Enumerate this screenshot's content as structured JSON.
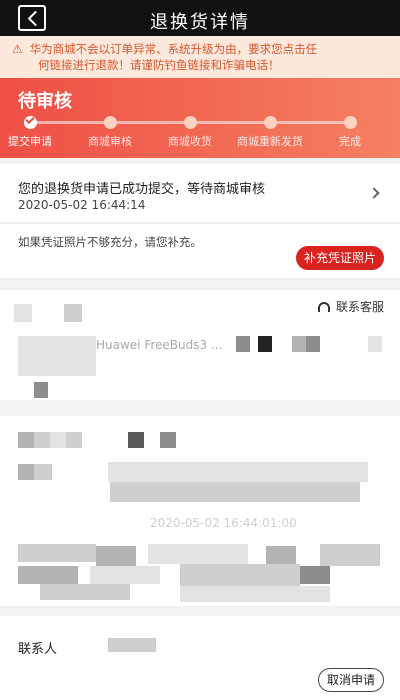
{
  "header": {
    "title": "退换货详情"
  },
  "notice": {
    "line1": "华为商城不会以订单异常、系统升级为由，要求您点击任",
    "line2": "何链接进行退款！请谨防钓鱼链接和诈骗电话！",
    "icon": "warning-icon"
  },
  "progress": {
    "status": "待审核",
    "completed_fraction": 0,
    "steps": [
      {
        "label": "提交申请",
        "active": true
      },
      {
        "label": "商城审核",
        "active": false
      },
      {
        "label": "商城收货",
        "active": false
      },
      {
        "label": "商城重新发货",
        "active": false
      },
      {
        "label": "完成",
        "active": false
      }
    ]
  },
  "status_card": {
    "message": "您的退换货申请已成功提交，等待商城审核",
    "time": "2020-05-02 16:44:14"
  },
  "supplement": {
    "text": "如果凭证照片不够充分，请您补充。",
    "button": "补充凭证照片"
  },
  "product": {
    "customer_service": "联系客服",
    "faint_text": "Huawei FreeBuds3 ..."
  },
  "order": {
    "faint_time": "2020-05-02 16:44:01:00"
  },
  "contact": {
    "label": "联系人",
    "cancel_button": "取消申请"
  },
  "colors": {
    "accent_red": "#d8231f",
    "progress_start": "#ef4f45",
    "progress_end": "#f58062",
    "notice_bg": "#fde8dd",
    "notice_text": "#d9572b"
  }
}
